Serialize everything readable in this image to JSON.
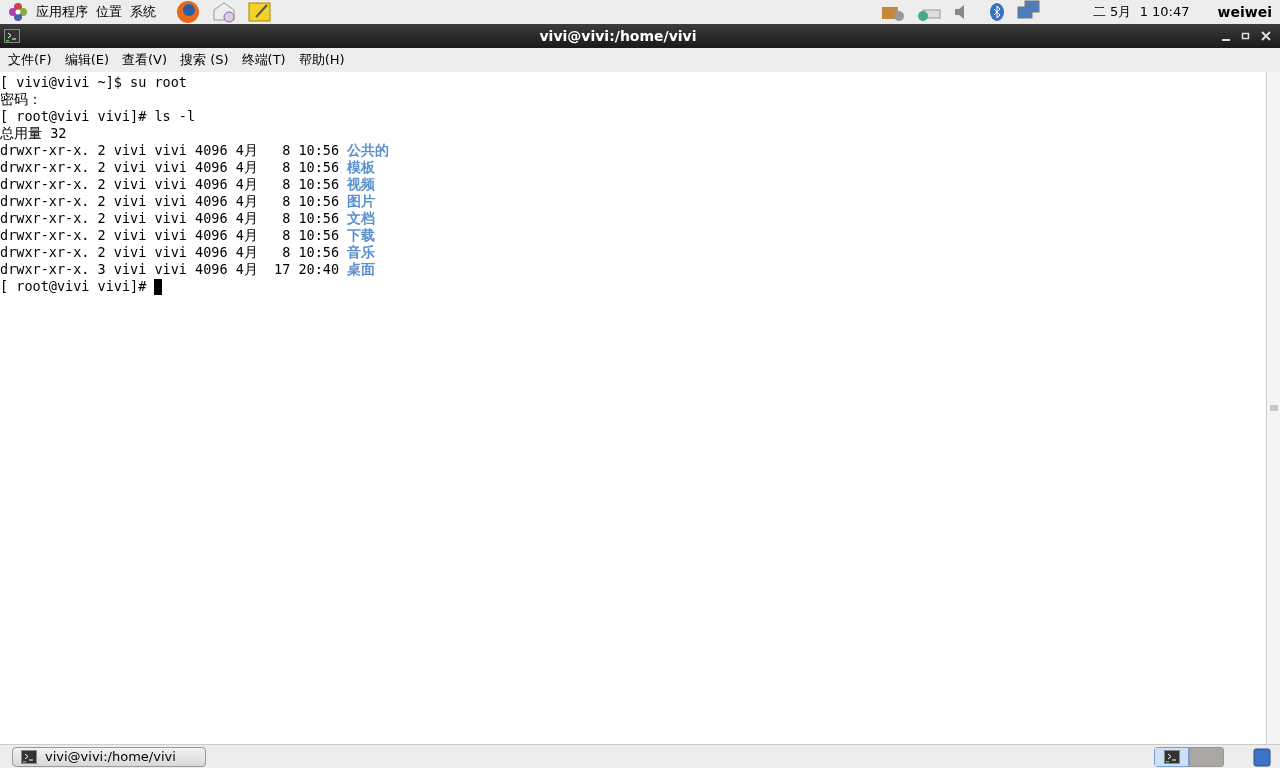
{
  "top_panel": {
    "menus": [
      "应用程序",
      "位置",
      "系统"
    ],
    "clock": "二 5月  1 10:47",
    "user": "weiwei"
  },
  "window": {
    "title": "vivi@vivi:/home/vivi"
  },
  "menubar": [
    "文件(F)",
    "编辑(E)",
    "查看(V)",
    "搜索 (S)",
    "终端(T)",
    "帮助(H)"
  ],
  "terminal": {
    "lines": [
      {
        "text": "[ vivi@vivi ~]$ su root"
      },
      {
        "text": "密码："
      },
      {
        "text": "[ root@vivi vivi]# ls -l"
      },
      {
        "text": "总用量 32"
      },
      {
        "text": "drwxr-xr-x. 2 vivi vivi 4096 4月   8 10:56 ",
        "dir": "公共的"
      },
      {
        "text": "drwxr-xr-x. 2 vivi vivi 4096 4月   8 10:56 ",
        "dir": "模板"
      },
      {
        "text": "drwxr-xr-x. 2 vivi vivi 4096 4月   8 10:56 ",
        "dir": "视频"
      },
      {
        "text": "drwxr-xr-x. 2 vivi vivi 4096 4月   8 10:56 ",
        "dir": "图片"
      },
      {
        "text": "drwxr-xr-x. 2 vivi vivi 4096 4月   8 10:56 ",
        "dir": "文档"
      },
      {
        "text": "drwxr-xr-x. 2 vivi vivi 4096 4月   8 10:56 ",
        "dir": "下载"
      },
      {
        "text": "drwxr-xr-x. 2 vivi vivi 4096 4月   8 10:56 ",
        "dir": "音乐"
      },
      {
        "text": "drwxr-xr-x. 3 vivi vivi 4096 4月  17 20:40 ",
        "dir": "桌面"
      },
      {
        "text": "[ root@vivi vivi]# ",
        "cursor": true
      }
    ]
  },
  "taskbar": {
    "tasks": [
      {
        "label": "vivi@vivi:/home/vivi",
        "selected": false
      }
    ],
    "workspaces": [
      {
        "selected": true
      },
      {
        "selected": false
      }
    ]
  }
}
